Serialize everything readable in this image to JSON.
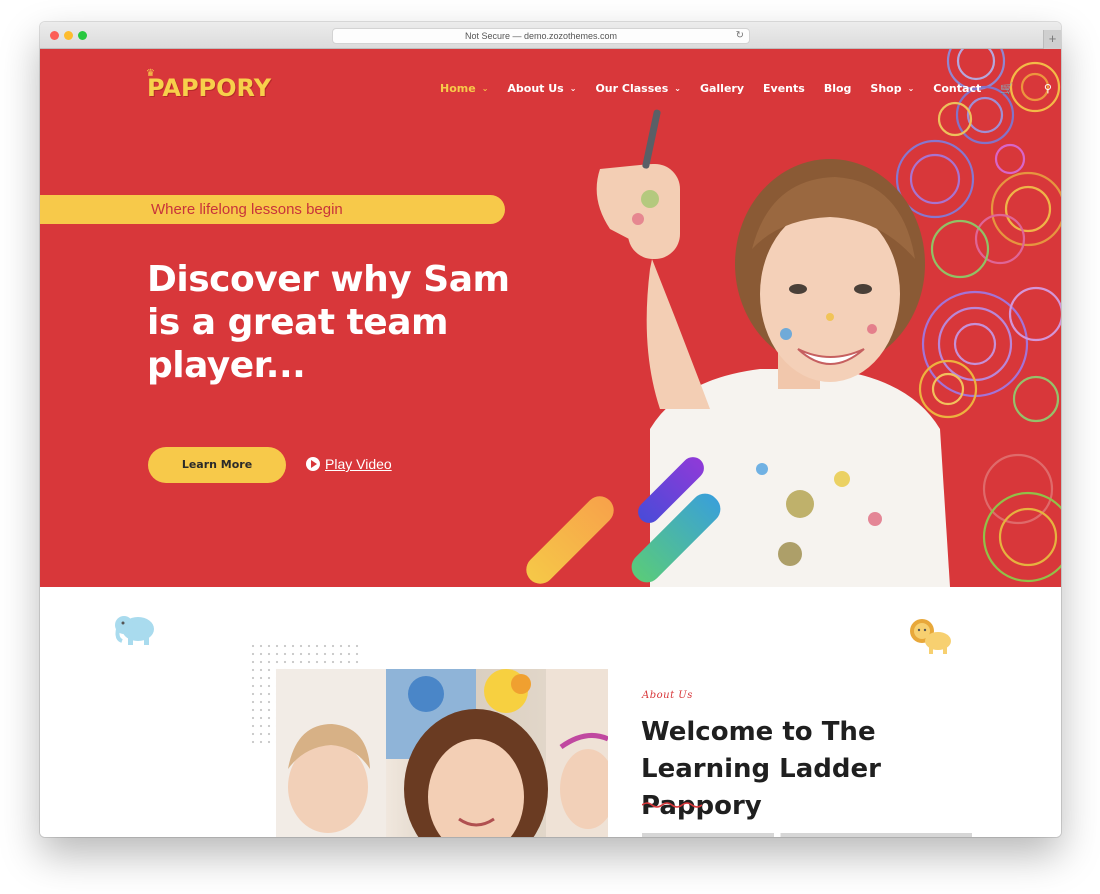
{
  "browser": {
    "url_text": "Not Secure — demo.zozothemes.com",
    "reload_icon": "reload-icon",
    "newtab_icon": "plus-icon"
  },
  "brand": {
    "logo_text": "PAPPORY",
    "colors": {
      "hero_bg": "#d8373a",
      "accent_yellow": "#f7c94a",
      "text_dark": "#1f1f1f"
    }
  },
  "nav": {
    "items": [
      {
        "label": "Home",
        "dropdown": true,
        "active": true
      },
      {
        "label": "About Us",
        "dropdown": true,
        "active": false
      },
      {
        "label": "Our Classes",
        "dropdown": true,
        "active": false
      },
      {
        "label": "Gallery",
        "dropdown": false,
        "active": false
      },
      {
        "label": "Events",
        "dropdown": false,
        "active": false
      },
      {
        "label": "Blog",
        "dropdown": false,
        "active": false
      },
      {
        "label": "Shop",
        "dropdown": true,
        "active": false
      },
      {
        "label": "Contact",
        "dropdown": false,
        "active": false
      }
    ],
    "cart_icon": "cart-icon",
    "search_icon": "search-icon"
  },
  "hero": {
    "tagline": "Where lifelong lessons begin",
    "headline": "Discover why Sam is a great team player...",
    "primary_button": "Learn More",
    "video_link": "Play Video"
  },
  "about": {
    "eyebrow": "About Us",
    "title": "Welcome to The Learning Ladder Pappory"
  }
}
